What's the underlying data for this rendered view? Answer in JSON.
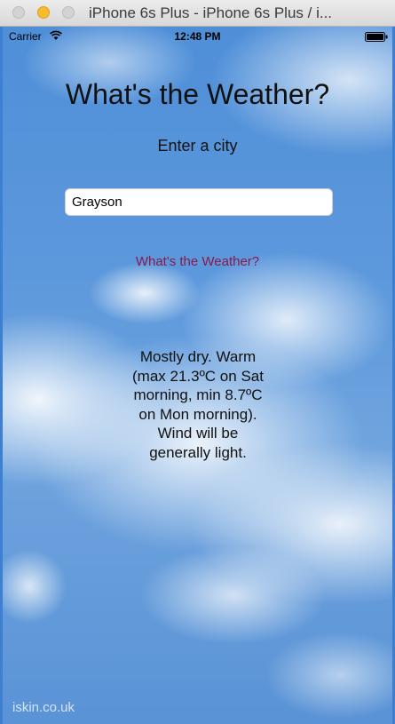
{
  "window": {
    "title": "iPhone 6s Plus - iPhone 6s Plus / i..."
  },
  "status_bar": {
    "carrier": "Carrier",
    "time": "12:48 PM"
  },
  "app": {
    "title": "What's the Weather?",
    "prompt": "Enter a city",
    "city_input": {
      "value": "Grayson",
      "placeholder": ""
    },
    "submit_label": "What's the Weather?",
    "forecast": "Mostly dry. Warm (max 21.3ºC on Sat morning, min 8.7ºC on Mon morning). Wind will be generally light."
  },
  "watermark": "iskin.co.uk",
  "colors": {
    "button_text": "#8b1a4c",
    "sky": "#4f8fd8"
  },
  "icons": [
    "wifi-icon",
    "battery-icon"
  ]
}
